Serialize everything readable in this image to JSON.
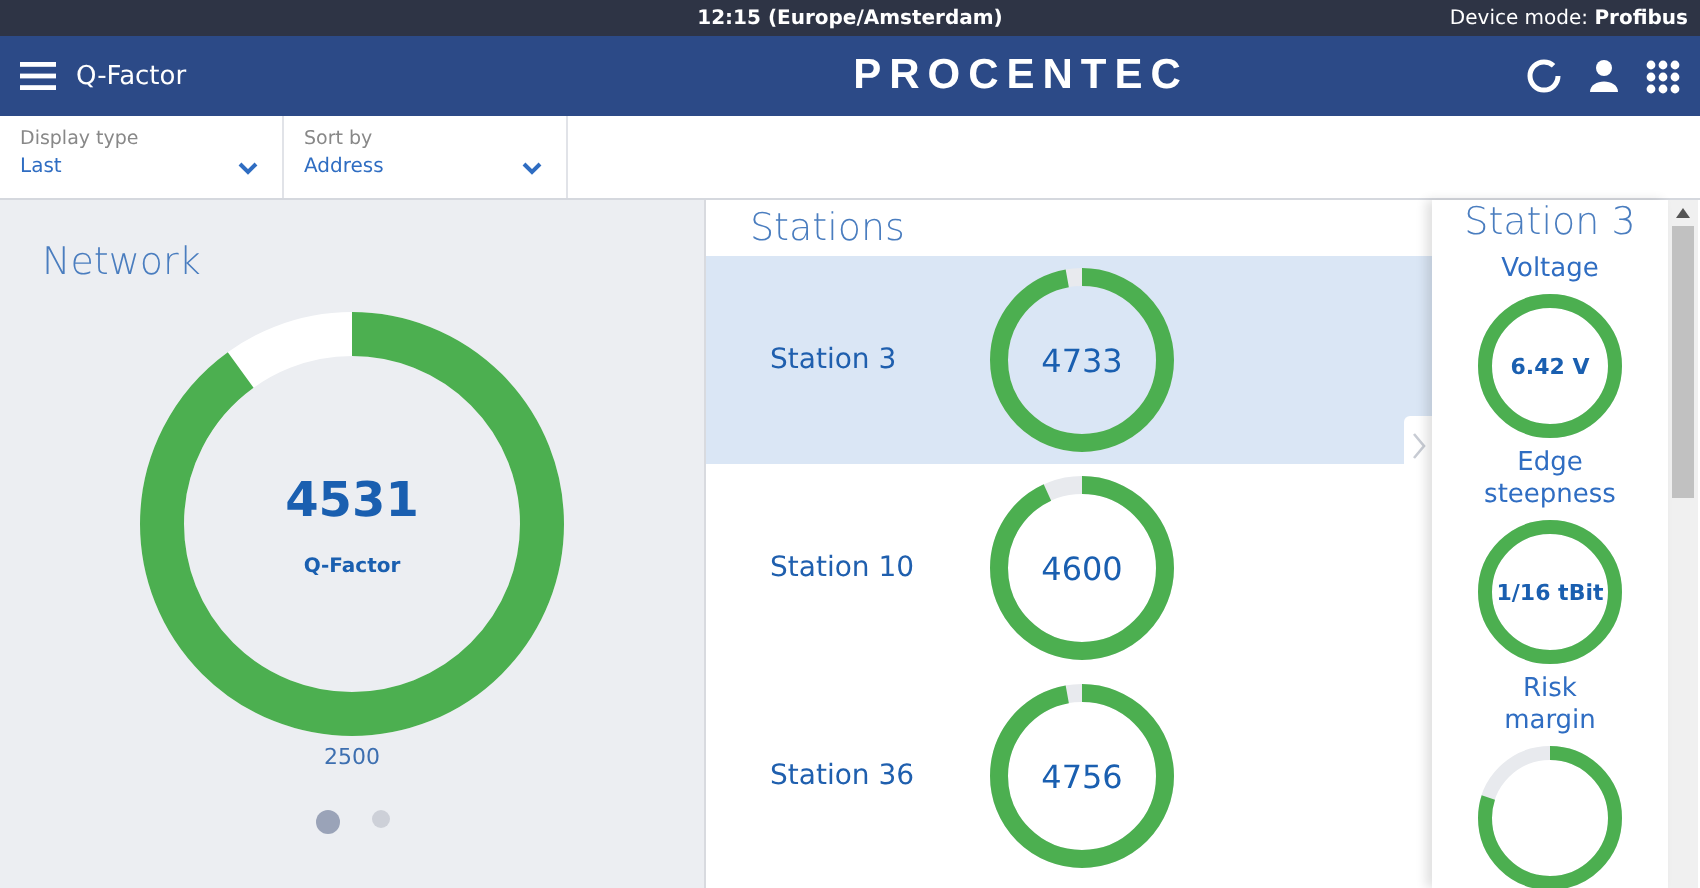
{
  "status_bar": {
    "time": "12:15 (Europe/Amsterdam)",
    "device_mode_label": "Device mode:",
    "device_mode": "Profibus"
  },
  "header": {
    "title": "Q-Factor",
    "logo": "PROCENTEC"
  },
  "filters": [
    {
      "label": "Display type",
      "value": "Last"
    },
    {
      "label": "Sort by",
      "value": "Address"
    }
  ],
  "network": {
    "title": "Network",
    "value": "4531",
    "caption": "Q-Factor",
    "level": 0.9,
    "minimum": "2500",
    "pages": [
      {
        "selected": true
      },
      {
        "selected": false
      }
    ]
  },
  "stations": {
    "title": "Stations",
    "rows": [
      {
        "name": "Station 3",
        "value": "4733",
        "level": 0.97,
        "selected": true
      },
      {
        "name": "Station 10",
        "value": "4600",
        "level": 0.93,
        "selected": false
      },
      {
        "name": "Station 36",
        "value": "4756",
        "level": 0.97,
        "selected": false
      }
    ]
  },
  "detail": {
    "title": "Station 3",
    "metrics": [
      {
        "label": "Voltage",
        "value": "6.42 V",
        "level": 1
      },
      {
        "label": "Edge steepness",
        "value": "1/16 tBit",
        "level": 1
      },
      {
        "label": "Risk margin",
        "level": 0.8
      }
    ]
  }
}
